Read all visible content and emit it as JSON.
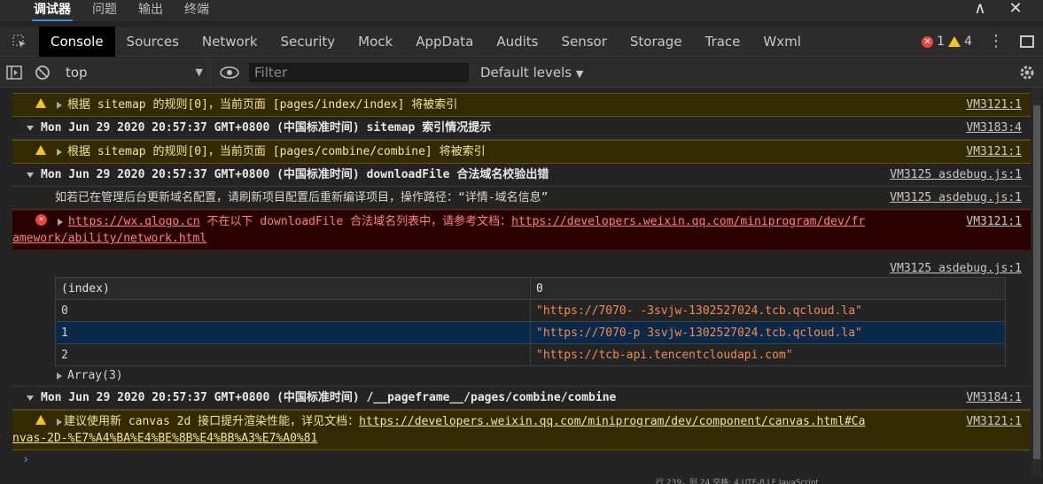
{
  "panel_tabs": [
    "调试器",
    "问题",
    "输出",
    "终端"
  ],
  "window": {
    "minimize": "∧",
    "close": "✕"
  },
  "devtools_tabs": [
    "Console",
    "Sources",
    "Network",
    "Security",
    "Mock",
    "AppData",
    "Audits",
    "Sensor",
    "Storage",
    "Trace",
    "Wxml"
  ],
  "counts": {
    "errors": "1",
    "warnings": "4"
  },
  "filter_bar": {
    "context": "top",
    "filter_placeholder": "Filter",
    "levels": "Default levels"
  },
  "console": {
    "rows": [
      {
        "type": "warn",
        "text": "根据 sitemap 的规则[0]，当前页面 [pages/index/index] 将被索引",
        "source": "VM3121:1"
      },
      {
        "type": "group",
        "text": "Mon Jun 29 2020 20:57:37 GMT+0800 (中国标准时间) sitemap 索引情况提示",
        "source": "VM3183:4"
      },
      {
        "type": "warn",
        "text": "根据 sitemap 的规则[0]，当前页面 [pages/combine/combine] 将被索引",
        "source": "VM3121:1"
      },
      {
        "type": "group",
        "text": "Mon Jun 29 2020 20:57:37 GMT+0800 (中国标准时间) downloadFile 合法域名校验出错",
        "source": "VM3125 asdebug.js:1"
      },
      {
        "type": "info",
        "text": "如若已在管理后台更新域名配置，请刷新项目配置后重新编译项目，操作路径：“详情-域名信息”",
        "source": "VM3125 asdebug.js:1"
      }
    ],
    "error_row": {
      "link1": "https://wx.qlogo.cn",
      "text1": " 不在以下 downloadFile 合法域名列表中，请参考文档：",
      "link2a": "https://developers.weixin.qq.com/miniprogram/dev/fr",
      "link2b": "amework/ability/network.html",
      "source": "VM3121:1"
    },
    "table_source": "VM3125 asdebug.js:1",
    "table": {
      "headers": [
        "(index)",
        "0"
      ],
      "rows": [
        {
          "index": "0",
          "value": "\"https://7070-        -3svjw-1302527024.tcb.qcloud.la\""
        },
        {
          "index": "1",
          "value": "\"https://7070-p        3svjw-1302527024.tcb.qcloud.la\""
        },
        {
          "index": "2",
          "value": "\"https://tcb-api.tencentcloudapi.com\""
        }
      ]
    },
    "array_label": "Array(3)",
    "group3": {
      "text": "Mon Jun 29 2020 20:57:37 GMT+0800 (中国标准时间) /__pageframe__/pages/combine/combine",
      "source": "VM3184:1"
    },
    "warn_canvas": {
      "text": "建议使用新 canvas 2d 接口提升渲染性能，详见文档：",
      "link_a": "https://developers.weixin.qq.com/miniprogram/dev/component/canvas.html#Ca",
      "link_b": "nvas-2D-%E7%A4%BA%E4%BE%8B%E4%BB%A3%E7%A0%81",
      "source": "VM3121:1"
    },
    "prompt": "›"
  },
  "status_bar": "行 239，列 24   空格: 4   UTF-8   LF   JavaScript"
}
